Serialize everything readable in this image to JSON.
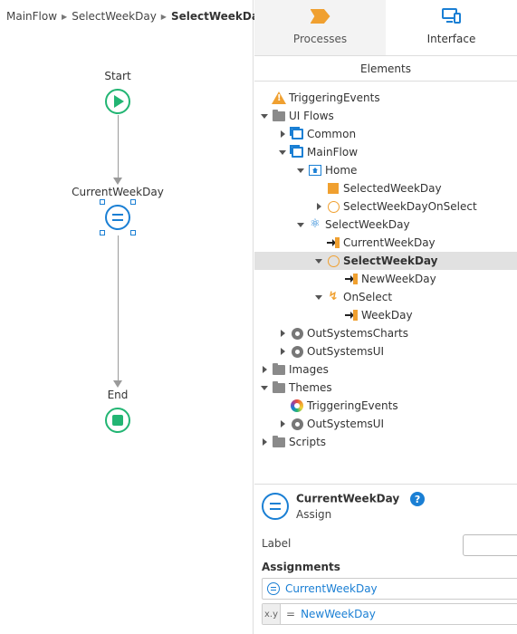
{
  "breadcrumb": [
    "MainFlow",
    "SelectWeekDay",
    "SelectWeekDay"
  ],
  "flow": {
    "start_label": "Start",
    "assign_label": "CurrentWeekDay",
    "end_label": "End"
  },
  "tabs": [
    {
      "label": "Processes",
      "icon": "process-chevron-icon",
      "active": false
    },
    {
      "label": "Interface",
      "icon": "device-icon",
      "active": true
    }
  ],
  "subtab": "Elements",
  "tree": [
    {
      "label": "TriggeringEvents",
      "icon": "warning-icon",
      "caret": "none",
      "depth": 0
    },
    {
      "label": "UI Flows",
      "icon": "folder-icon",
      "caret": "down",
      "depth": 0
    },
    {
      "label": "Common",
      "icon": "ui-flow-icon",
      "caret": "right",
      "depth": 1
    },
    {
      "label": "MainFlow",
      "icon": "ui-flow-icon",
      "caret": "down",
      "depth": 1
    },
    {
      "label": "Home",
      "icon": "screen-icon",
      "caret": "down",
      "depth": 2
    },
    {
      "label": "SelectedWeekDay",
      "icon": "local-variable-icon",
      "caret": "none",
      "depth": 3
    },
    {
      "label": "SelectWeekDayOnSelect",
      "icon": "client-action-icon",
      "caret": "right",
      "depth": 3
    },
    {
      "label": "SelectWeekDay",
      "icon": "block-icon",
      "caret": "down",
      "depth": 2
    },
    {
      "label": "CurrentWeekDay",
      "icon": "input-parameter-icon",
      "caret": "none",
      "depth": 3
    },
    {
      "label": "SelectWeekDay",
      "icon": "client-action-icon",
      "caret": "down",
      "depth": 3,
      "selected": true
    },
    {
      "label": "NewWeekDay",
      "icon": "input-parameter-icon",
      "caret": "none",
      "depth": 4
    },
    {
      "label": "OnSelect",
      "icon": "event-icon",
      "caret": "down",
      "depth": 3
    },
    {
      "label": "WeekDay",
      "icon": "input-parameter-icon",
      "caret": "none",
      "depth": 4
    },
    {
      "label": "OutSystemsCharts",
      "icon": "module-icon",
      "caret": "right",
      "depth": 1
    },
    {
      "label": "OutSystemsUI",
      "icon": "module-icon",
      "caret": "right",
      "depth": 1
    },
    {
      "label": "Images",
      "icon": "folder-icon",
      "caret": "right",
      "depth": 0
    },
    {
      "label": "Themes",
      "icon": "folder-icon",
      "caret": "down",
      "depth": 0
    },
    {
      "label": "TriggeringEvents",
      "icon": "theme-icon",
      "caret": "none",
      "depth": 1
    },
    {
      "label": "OutSystemsUI",
      "icon": "module-icon",
      "caret": "right",
      "depth": 1
    },
    {
      "label": "Scripts",
      "icon": "folder-icon",
      "caret": "right",
      "depth": 0
    }
  ],
  "properties": {
    "title": "CurrentWeekDay",
    "subtitle": "Assign",
    "help": "?",
    "label_field": "Label",
    "label_value": "",
    "assignments_title": "Assignments",
    "assign_target": "CurrentWeekDay",
    "assign_xy": "x.y",
    "assign_eq": "=",
    "assign_value": "NewWeekDay"
  },
  "colors": {
    "accent": "#1a7fd4",
    "success": "#22b573",
    "warning": "#f0a030",
    "selected_row": "#e1e1e1"
  }
}
